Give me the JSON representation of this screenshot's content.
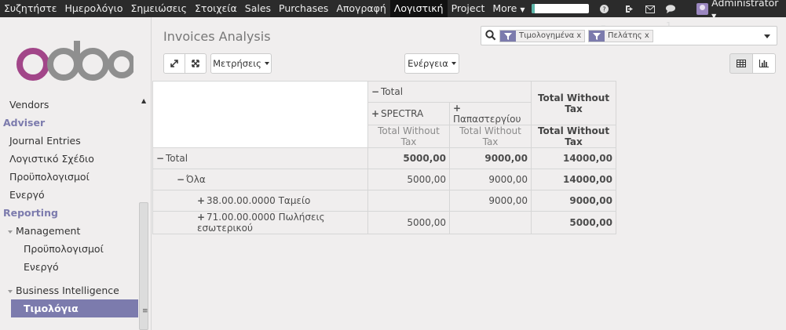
{
  "topbar": {
    "menu": [
      "Συζητήστε",
      "Ημερολόγιο",
      "Σημειώσεις",
      "Στοιχεία",
      "Sales",
      "Purchases",
      "Απογραφή",
      "Λογιστική",
      "Project",
      "More"
    ],
    "active_index": 7,
    "progress_fraction": 0.05,
    "chat_count": "1",
    "user": "Administrator"
  },
  "sidebar": {
    "logo": "odoo",
    "items": [
      {
        "label": "Vendors",
        "level": "l1"
      },
      {
        "label": "Adviser",
        "level": "hdr"
      },
      {
        "label": "Journal Entries",
        "level": "l1"
      },
      {
        "label": "Λογιστικό Σχέδιο",
        "level": "l1"
      },
      {
        "label": "Προϋπολογισμοί",
        "level": "l1"
      },
      {
        "label": "Ενεργό",
        "level": "l1"
      },
      {
        "label": "Reporting",
        "level": "hdr"
      },
      {
        "label": "Management",
        "level": "l2"
      },
      {
        "label": "Προϋπολογισμοί",
        "level": "l3"
      },
      {
        "label": "Ενεργό",
        "level": "l3"
      },
      {
        "label": "Business Intelligence",
        "level": "l2"
      },
      {
        "label": "Τιμολόγια",
        "level": "sel"
      }
    ]
  },
  "main": {
    "title": "Invoices Analysis",
    "search": {
      "facets": [
        "Τιμολογημένα",
        "Πελάτης"
      ],
      "remove_glyph": "x"
    },
    "buttons": {
      "measures": "Μετρήσεις",
      "actions": "Ενέργεια"
    }
  },
  "pivot": {
    "col_total": "Total",
    "col_groups": [
      "SPECTRA",
      "Παπαστεργίου"
    ],
    "measure": "Total Without Tax",
    "grand_total_header": "Total Without Tax",
    "rows": [
      {
        "label": "Total",
        "sign": "−",
        "indent": 0,
        "values": [
          "5000,00",
          "9000,00",
          "14000,00"
        ],
        "bold": true
      },
      {
        "label": "Όλα",
        "sign": "−",
        "indent": 1,
        "values": [
          "5000,00",
          "9000,00",
          "14000,00"
        ],
        "bold": false
      },
      {
        "label": "38.00.00.0000 Ταμείο",
        "sign": "+",
        "indent": 2,
        "values": [
          "",
          "9000,00",
          "9000,00"
        ],
        "bold": false
      },
      {
        "label": "71.00.00.0000 Πωλήσεις εσωτερικού",
        "sign": "+",
        "indent": 2,
        "values": [
          "5000,00",
          "",
          "5000,00"
        ],
        "bold": false
      }
    ]
  }
}
